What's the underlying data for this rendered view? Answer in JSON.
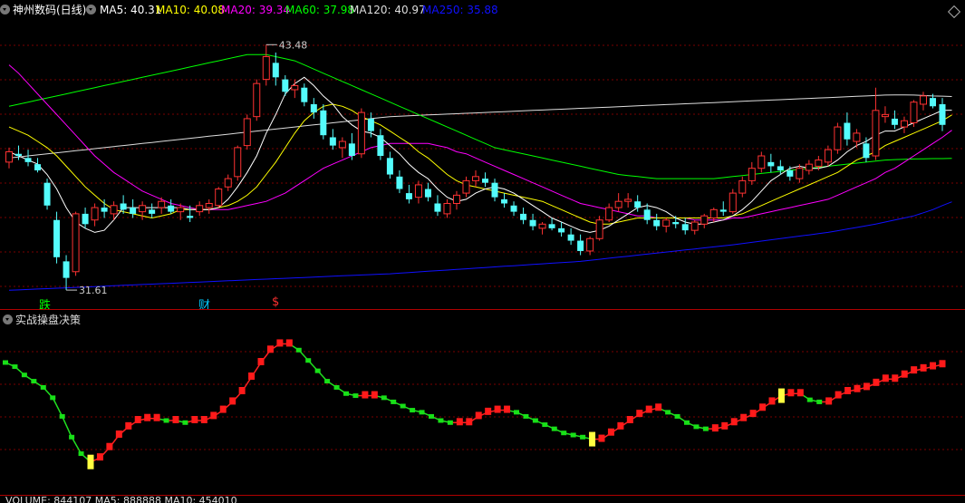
{
  "main_panel": {
    "title": "神州数码(日线)",
    "ma_items": [
      {
        "label": "MA5: 40.31",
        "color": "#ffffff"
      },
      {
        "label": "MA10: 40.08",
        "color": "#ffff00"
      },
      {
        "label": "MA20: 39.34",
        "color": "#ff00ff"
      },
      {
        "label": "MA60: 37.98",
        "color": "#00ff00"
      },
      {
        "label": "MA120: 40.97",
        "color": "#dddddd"
      },
      {
        "label": "MA250: 35.88",
        "color": "#1010ff"
      }
    ],
    "high_label": "43.48",
    "low_label": "31.61",
    "markers": [
      {
        "text": "跌",
        "color": "#00ff00"
      },
      {
        "text": "财",
        "color": "#00ccff"
      },
      {
        "text": "$",
        "color": "#ff3030"
      }
    ],
    "corner_icon": "diamond-icon"
  },
  "indicator_panel": {
    "title": "实战操盘决策"
  },
  "volume_panel": {
    "label": "VOLUME: 844107 MA5: 888888 MA10: 454010"
  },
  "colors": {
    "up": "#ff3232",
    "down": "#54fcfc",
    "grid": "#7a0000",
    "separator": "#b00000"
  },
  "chart_data": {
    "type": "candlestick",
    "candles": [
      [
        37.8,
        38.5,
        37.5,
        38.3
      ],
      [
        38.2,
        38.6,
        37.9,
        38.1
      ],
      [
        38.0,
        38.4,
        37.6,
        37.8
      ],
      [
        37.7,
        38.0,
        37.3,
        37.4
      ],
      [
        36.8,
        37.0,
        35.5,
        35.7
      ],
      [
        35.0,
        35.4,
        32.9,
        33.2
      ],
      [
        33.0,
        33.3,
        31.61,
        32.2
      ],
      [
        32.5,
        35.4,
        32.3,
        35.3
      ],
      [
        35.3,
        35.6,
        34.6,
        34.8
      ],
      [
        35.0,
        35.8,
        34.7,
        35.6
      ],
      [
        35.6,
        36.0,
        35.1,
        35.4
      ],
      [
        35.3,
        35.9,
        35.0,
        35.7
      ],
      [
        35.8,
        36.2,
        35.3,
        35.5
      ],
      [
        35.6,
        36.0,
        35.1,
        35.3
      ],
      [
        35.4,
        35.9,
        35.0,
        35.7
      ],
      [
        35.5,
        35.8,
        35.1,
        35.3
      ],
      [
        35.6,
        36.1,
        35.3,
        35.9
      ],
      [
        35.7,
        36.0,
        35.3,
        35.4
      ],
      [
        35.4,
        35.8,
        35.0,
        35.6
      ],
      [
        35.2,
        35.7,
        34.9,
        35.1
      ],
      [
        35.4,
        35.9,
        35.2,
        35.7
      ],
      [
        35.6,
        36.0,
        35.3,
        35.8
      ],
      [
        35.7,
        36.6,
        35.6,
        36.5
      ],
      [
        36.6,
        37.2,
        36.4,
        37.0
      ],
      [
        37.1,
        38.6,
        36.9,
        38.5
      ],
      [
        38.6,
        40.1,
        38.4,
        39.9
      ],
      [
        40.0,
        41.8,
        39.8,
        41.6
      ],
      [
        41.8,
        43.48,
        41.5,
        42.9
      ],
      [
        42.6,
        43.1,
        41.5,
        41.9
      ],
      [
        41.8,
        42.0,
        41.0,
        41.2
      ],
      [
        41.3,
        41.8,
        40.9,
        41.5
      ],
      [
        41.4,
        41.6,
        40.5,
        40.7
      ],
      [
        40.6,
        40.9,
        39.9,
        40.2
      ],
      [
        40.3,
        40.6,
        38.9,
        39.1
      ],
      [
        39.0,
        39.4,
        38.4,
        38.6
      ],
      [
        38.5,
        39.0,
        38.0,
        38.8
      ],
      [
        38.7,
        39.2,
        37.9,
        38.1
      ],
      [
        38.2,
        40.4,
        38.0,
        40.2
      ],
      [
        39.9,
        40.2,
        39.0,
        39.3
      ],
      [
        39.1,
        39.4,
        37.9,
        38.1
      ],
      [
        38.0,
        38.3,
        37.0,
        37.2
      ],
      [
        37.1,
        37.4,
        36.3,
        36.5
      ],
      [
        36.3,
        36.7,
        35.8,
        36.0
      ],
      [
        36.1,
        36.9,
        35.8,
        36.7
      ],
      [
        36.5,
        36.8,
        35.9,
        36.1
      ],
      [
        35.8,
        36.2,
        35.2,
        35.4
      ],
      [
        35.3,
        36.0,
        35.1,
        35.8
      ],
      [
        35.8,
        36.4,
        35.5,
        36.2
      ],
      [
        36.3,
        37.1,
        36.1,
        36.9
      ],
      [
        36.9,
        37.4,
        36.6,
        37.1
      ],
      [
        37.0,
        37.3,
        36.6,
        36.8
      ],
      [
        36.8,
        37.0,
        35.9,
        36.1
      ],
      [
        36.0,
        36.3,
        35.6,
        35.8
      ],
      [
        35.7,
        35.9,
        35.2,
        35.4
      ],
      [
        35.3,
        35.6,
        34.8,
        35.0
      ],
      [
        35.0,
        35.3,
        34.5,
        34.7
      ],
      [
        34.6,
        34.9,
        34.3,
        34.8
      ],
      [
        34.8,
        35.1,
        34.5,
        34.6
      ],
      [
        34.6,
        34.9,
        34.2,
        34.4
      ],
      [
        34.3,
        34.6,
        33.8,
        34.0
      ],
      [
        34.0,
        34.3,
        33.3,
        33.5
      ],
      [
        33.5,
        34.2,
        33.3,
        34.1
      ],
      [
        34.1,
        35.2,
        34.0,
        35.0
      ],
      [
        35.0,
        35.8,
        34.9,
        35.6
      ],
      [
        35.6,
        36.3,
        35.4,
        35.9
      ],
      [
        35.9,
        36.3,
        35.6,
        36.0
      ],
      [
        35.9,
        36.2,
        35.4,
        35.6
      ],
      [
        35.5,
        35.8,
        34.8,
        35.0
      ],
      [
        35.0,
        35.3,
        34.5,
        34.7
      ],
      [
        34.7,
        35.1,
        34.4,
        35.0
      ],
      [
        34.9,
        35.2,
        34.6,
        34.8
      ],
      [
        34.8,
        35.1,
        34.3,
        34.5
      ],
      [
        34.5,
        35.0,
        34.3,
        34.9
      ],
      [
        34.8,
        35.3,
        34.6,
        35.2
      ],
      [
        35.1,
        35.6,
        34.9,
        35.5
      ],
      [
        35.5,
        35.9,
        35.2,
        35.4
      ],
      [
        35.4,
        36.5,
        35.3,
        36.3
      ],
      [
        36.3,
        37.1,
        36.1,
        36.9
      ],
      [
        36.9,
        37.8,
        36.7,
        37.5
      ],
      [
        37.5,
        38.3,
        37.3,
        38.1
      ],
      [
        37.8,
        38.2,
        37.3,
        37.6
      ],
      [
        37.6,
        37.9,
        37.2,
        37.4
      ],
      [
        37.4,
        37.6,
        36.9,
        37.1
      ],
      [
        37.0,
        37.7,
        36.8,
        37.5
      ],
      [
        37.4,
        37.9,
        37.2,
        37.7
      ],
      [
        37.6,
        38.1,
        37.4,
        37.9
      ],
      [
        37.8,
        38.6,
        37.6,
        38.4
      ],
      [
        38.4,
        39.7,
        38.2,
        39.5
      ],
      [
        39.7,
        40.2,
        38.6,
        38.9
      ],
      [
        38.8,
        39.4,
        38.5,
        39.2
      ],
      [
        38.7,
        39.0,
        37.8,
        38.0
      ],
      [
        38.1,
        41.4,
        37.9,
        40.3
      ],
      [
        40.0,
        40.5,
        39.7,
        40.1
      ],
      [
        39.9,
        40.3,
        39.4,
        39.6
      ],
      [
        39.5,
        40.0,
        39.2,
        39.8
      ],
      [
        39.7,
        40.8,
        39.5,
        40.7
      ],
      [
        40.6,
        41.2,
        40.3,
        41.0
      ],
      [
        40.9,
        41.1,
        40.4,
        40.5
      ],
      [
        40.6,
        40.9,
        39.3,
        39.6
      ]
    ],
    "ma5": [
      38.3,
      38.1,
      37.9,
      37.7,
      37.2,
      36.5,
      35.6,
      34.9,
      34.6,
      34.4,
      34.5,
      35.0,
      35.6,
      35.6,
      35.6,
      35.6,
      35.6,
      35.6,
      35.6,
      35.5,
      35.5,
      35.5,
      35.6,
      36.0,
      36.6,
      37.3,
      38.1,
      39.2,
      40.1,
      41.1,
      41.6,
      41.9,
      41.5,
      41.0,
      40.6,
      40.0,
      39.6,
      39.3,
      39.2,
      39.0,
      38.6,
      38.2,
      37.7,
      37.3,
      37.0,
      36.5,
      36.1,
      35.9,
      36.0,
      36.3,
      36.5,
      36.6,
      36.5,
      36.3,
      36.0,
      35.7,
      35.4,
      35.1,
      34.9,
      34.7,
      34.5,
      34.4,
      34.5,
      34.7,
      35.0,
      35.3,
      35.6,
      35.7,
      35.6,
      35.4,
      35.1,
      34.9,
      34.8,
      34.8,
      34.9,
      35.0,
      35.2,
      35.5,
      35.9,
      36.4,
      36.9,
      37.2,
      37.5,
      37.6,
      37.5,
      37.5,
      37.6,
      37.9,
      38.3,
      38.6,
      38.8,
      39.1,
      39.3,
      39.3,
      39.5,
      39.7,
      39.9,
      40.1,
      40.3,
      40.31
    ],
    "ma10": [
      39.5,
      39.3,
      39.1,
      38.8,
      38.5,
      38.1,
      37.6,
      37.1,
      36.6,
      36.2,
      35.8,
      35.5,
      35.4,
      35.3,
      35.2,
      35.1,
      35.2,
      35.3,
      35.5,
      35.5,
      35.5,
      35.5,
      35.6,
      35.7,
      35.9,
      36.2,
      36.6,
      37.2,
      37.8,
      38.5,
      39.2,
      39.8,
      40.2,
      40.5,
      40.6,
      40.5,
      40.3,
      40.0,
      39.8,
      39.6,
      39.3,
      39.0,
      38.7,
      38.3,
      38.0,
      37.6,
      37.2,
      36.9,
      36.7,
      36.6,
      36.5,
      36.4,
      36.3,
      36.2,
      36.1,
      36.0,
      35.9,
      35.7,
      35.5,
      35.3,
      35.1,
      34.9,
      34.8,
      34.8,
      34.9,
      35.0,
      35.1,
      35.1,
      35.1,
      35.1,
      35.1,
      35.1,
      35.1,
      35.1,
      35.1,
      35.1,
      35.2,
      35.3,
      35.5,
      35.7,
      35.9,
      36.1,
      36.3,
      36.5,
      36.7,
      36.9,
      37.1,
      37.3,
      37.6,
      37.9,
      38.1,
      38.3,
      38.6,
      38.8,
      39.0,
      39.2,
      39.4,
      39.6,
      39.8,
      40.08
    ],
    "ma20": [
      42.5,
      42.1,
      41.6,
      41.1,
      40.6,
      40.1,
      39.6,
      39.1,
      38.6,
      38.1,
      37.7,
      37.3,
      37.0,
      36.7,
      36.4,
      36.2,
      36.0,
      35.8,
      35.7,
      35.6,
      35.5,
      35.5,
      35.5,
      35.5,
      35.6,
      35.7,
      35.8,
      35.9,
      36.1,
      36.3,
      36.6,
      36.9,
      37.2,
      37.5,
      37.7,
      37.9,
      38.1,
      38.3,
      38.5,
      38.6,
      38.7,
      38.7,
      38.7,
      38.7,
      38.7,
      38.6,
      38.5,
      38.3,
      38.2,
      38.0,
      37.8,
      37.6,
      37.4,
      37.2,
      37.0,
      36.8,
      36.6,
      36.4,
      36.2,
      36.0,
      35.8,
      35.7,
      35.6,
      35.5,
      35.4,
      35.3,
      35.2,
      35.2,
      35.1,
      35.1,
      35.1,
      35.1,
      35.0,
      35.0,
      35.0,
      35.0,
      35.1,
      35.1,
      35.2,
      35.3,
      35.4,
      35.5,
      35.6,
      35.7,
      35.8,
      35.9,
      36.0,
      36.2,
      36.4,
      36.6,
      36.8,
      37.0,
      37.3,
      37.5,
      37.8,
      38.1,
      38.4,
      38.7,
      39.0,
      39.34
    ],
    "ma60": [
      40.5,
      40.6,
      40.7,
      40.8,
      40.9,
      41.0,
      41.1,
      41.2,
      41.3,
      41.4,
      41.5,
      41.6,
      41.7,
      41.8,
      41.9,
      42.0,
      42.1,
      42.2,
      42.3,
      42.4,
      42.5,
      42.6,
      42.7,
      42.8,
      42.9,
      43.0,
      43.0,
      43.0,
      42.9,
      42.8,
      42.7,
      42.5,
      42.3,
      42.1,
      41.9,
      41.7,
      41.5,
      41.3,
      41.1,
      40.9,
      40.7,
      40.5,
      40.3,
      40.1,
      39.9,
      39.7,
      39.5,
      39.3,
      39.1,
      38.9,
      38.7,
      38.5,
      38.4,
      38.3,
      38.2,
      38.1,
      38.0,
      37.9,
      37.8,
      37.7,
      37.6,
      37.5,
      37.4,
      37.3,
      37.2,
      37.15,
      37.1,
      37.05,
      37.0,
      37.0,
      37.0,
      37.0,
      37.0,
      37.0,
      37.0,
      37.05,
      37.1,
      37.15,
      37.2,
      37.25,
      37.3,
      37.35,
      37.4,
      37.45,
      37.5,
      37.55,
      37.6,
      37.65,
      37.7,
      37.75,
      37.8,
      37.85,
      37.9,
      37.92,
      37.94,
      37.95,
      37.96,
      37.97,
      37.97,
      37.98
    ],
    "ma120": [
      38.0,
      38.05,
      38.1,
      38.15,
      38.2,
      38.25,
      38.3,
      38.35,
      38.4,
      38.45,
      38.5,
      38.55,
      38.6,
      38.65,
      38.7,
      38.75,
      38.8,
      38.85,
      38.9,
      38.95,
      39.0,
      39.05,
      39.1,
      39.15,
      39.2,
      39.25,
      39.3,
      39.35,
      39.4,
      39.45,
      39.5,
      39.55,
      39.6,
      39.65,
      39.7,
      39.75,
      39.8,
      39.85,
      39.9,
      39.95,
      40.0,
      40.02,
      40.04,
      40.06,
      40.08,
      40.1,
      40.12,
      40.14,
      40.16,
      40.18,
      40.2,
      40.22,
      40.24,
      40.26,
      40.28,
      40.3,
      40.32,
      40.34,
      40.36,
      40.38,
      40.4,
      40.42,
      40.44,
      40.46,
      40.48,
      40.5,
      40.52,
      40.54,
      40.56,
      40.58,
      40.6,
      40.62,
      40.64,
      40.66,
      40.68,
      40.7,
      40.72,
      40.74,
      40.76,
      40.78,
      40.8,
      40.82,
      40.84,
      40.86,
      40.88,
      40.9,
      40.92,
      40.94,
      40.96,
      40.98,
      41.0,
      41.02,
      41.04,
      41.05,
      41.05,
      41.04,
      41.02,
      41.0,
      40.99,
      40.97
    ],
    "ma250": [
      31.6,
      31.62,
      31.64,
      31.66,
      31.68,
      31.7,
      31.72,
      31.74,
      31.76,
      31.78,
      31.8,
      31.82,
      31.84,
      31.86,
      31.88,
      31.9,
      31.92,
      31.94,
      31.96,
      31.98,
      32.0,
      32.02,
      32.04,
      32.06,
      32.08,
      32.1,
      32.12,
      32.14,
      32.16,
      32.18,
      32.2,
      32.22,
      32.24,
      32.26,
      32.28,
      32.3,
      32.32,
      32.34,
      32.36,
      32.38,
      32.4,
      32.43,
      32.46,
      32.49,
      32.52,
      32.55,
      32.58,
      32.61,
      32.64,
      32.67,
      32.7,
      32.73,
      32.76,
      32.79,
      32.82,
      32.85,
      32.88,
      32.91,
      32.94,
      32.97,
      33.0,
      33.05,
      33.1,
      33.15,
      33.2,
      33.25,
      33.3,
      33.35,
      33.4,
      33.45,
      33.5,
      33.55,
      33.6,
      33.65,
      33.7,
      33.75,
      33.8,
      33.86,
      33.92,
      33.98,
      34.04,
      34.1,
      34.16,
      34.22,
      34.28,
      34.34,
      34.4,
      34.48,
      34.56,
      34.64,
      34.72,
      34.8,
      34.9,
      35.0,
      35.1,
      35.2,
      35.35,
      35.5,
      35.7,
      35.88
    ],
    "ylim": [
      31.0,
      44.5
    ],
    "indicator": {
      "values": [
        86,
        84,
        80,
        77,
        74,
        69,
        60,
        50,
        42,
        38,
        40,
        45,
        51,
        55,
        58,
        59,
        59,
        58,
        58,
        57,
        58,
        58,
        60,
        63,
        67,
        72,
        79,
        86,
        92,
        95,
        95,
        92,
        87,
        82,
        77,
        74,
        71,
        70,
        70,
        70,
        69,
        67,
        65,
        63,
        62,
        60,
        58,
        57,
        57,
        57,
        60,
        62,
        63,
        63,
        62,
        60,
        58,
        56,
        54,
        52,
        51,
        50,
        49,
        49,
        52,
        55,
        58,
        61,
        63,
        64,
        62,
        60,
        57,
        55,
        54,
        54,
        55,
        57,
        59,
        61,
        64,
        67,
        70,
        71,
        71,
        68,
        67,
        67,
        70,
        72,
        73,
        74,
        76,
        78,
        78,
        80,
        82,
        83,
        84,
        85
      ],
      "signals": [
        {
          "index": 9,
          "type": "yellow"
        },
        {
          "index": 62,
          "type": "yellow"
        },
        {
          "index": 82,
          "type": "yellow"
        }
      ],
      "ylim": [
        30,
        100
      ]
    }
  }
}
